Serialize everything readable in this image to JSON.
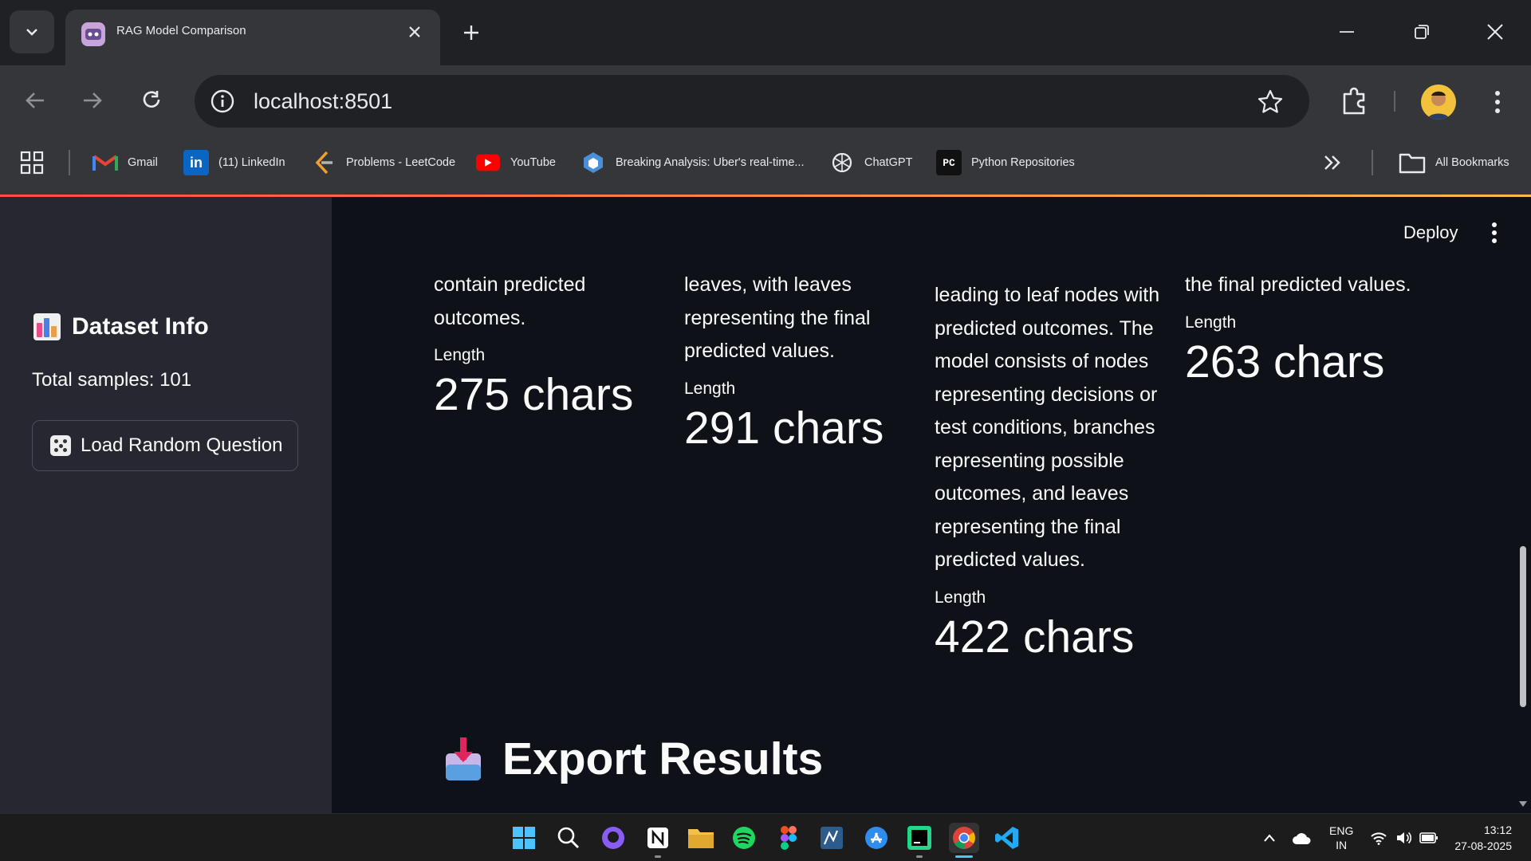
{
  "browser": {
    "tab_title": "RAG Model Comparison",
    "url": "localhost:8501",
    "bookmarks": [
      {
        "label": "Gmail",
        "icon": "gmail-icon"
      },
      {
        "label": "(11) LinkedIn",
        "icon": "linkedin-icon"
      },
      {
        "label": "Problems - LeetCode",
        "icon": "leetcode-icon"
      },
      {
        "label": "YouTube",
        "icon": "youtube-icon"
      },
      {
        "label": "Breaking Analysis: Uber's real-time...",
        "icon": "article-icon"
      },
      {
        "label": "ChatGPT",
        "icon": "chatgpt-icon"
      },
      {
        "label": "Python Repositories",
        "icon": "pycharm-icon"
      }
    ],
    "all_bookmarks_label": "All Bookmarks"
  },
  "sidebar": {
    "title": "Dataset Info",
    "total_samples": "Total samples: 101",
    "load_button": "Load Random Question"
  },
  "main": {
    "deploy_label": "Deploy",
    "columns": [
      {
        "lines": [
          "contain predicted",
          "outcomes."
        ],
        "label": "Length",
        "metric": "275 chars"
      },
      {
        "lines": [
          "leaves, with leaves",
          "representing the final",
          "predicted values."
        ],
        "label": "Length",
        "metric": "291 chars"
      },
      {
        "lines": [
          "leading to leaf nodes with",
          "predicted outcomes. The",
          "model consists of nodes",
          "representing decisions or",
          "test conditions, branches",
          "representing possible",
          "outcomes, and leaves",
          "representing the final",
          "predicted values."
        ],
        "label": "Length",
        "metric": "422 chars"
      },
      {
        "lines": [
          "the final predicted values."
        ],
        "label": "Length",
        "metric": "263 chars"
      }
    ],
    "export_title": "Export Results"
  },
  "taskbar": {
    "lang_top": "ENG",
    "lang_bottom": "IN",
    "time": "13:12",
    "date": "27-08-2025"
  },
  "colors": {
    "app_bg": "#0e1117",
    "sidebar_bg": "#262730",
    "accent": "#ff4b4b"
  }
}
